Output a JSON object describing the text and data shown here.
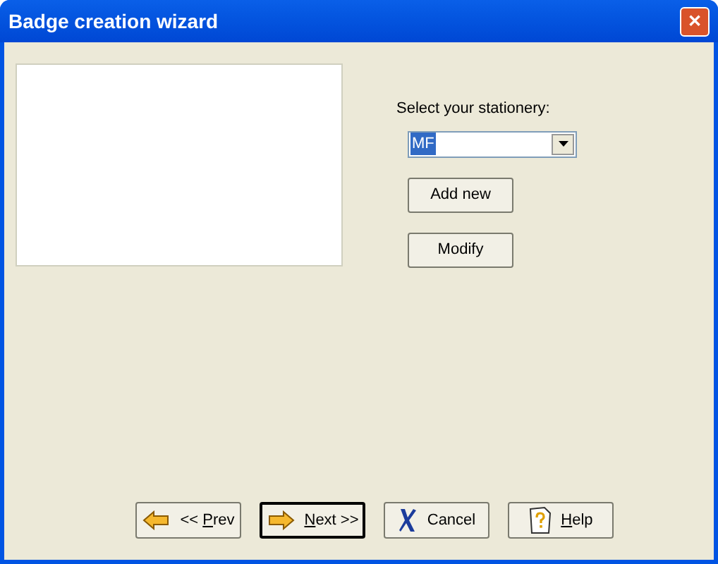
{
  "window": {
    "title": "Badge creation wizard",
    "close": "✕"
  },
  "preview": {
    "kind": "blank"
  },
  "stationery": {
    "label": "Select your stationery:",
    "value": "MF",
    "selected_text": true
  },
  "side_buttons": [
    {
      "label": "Add new"
    },
    {
      "label": "Modify"
    }
  ],
  "nav_buttons": [
    {
      "kind": "prev",
      "before": "<< ",
      "key": "P",
      "after": "rev",
      "default": false
    },
    {
      "kind": "next",
      "key": "N",
      "after": "ext >>",
      "default": true
    },
    {
      "kind": "cancel",
      "before": "Cancel",
      "default": false
    },
    {
      "kind": "help",
      "key": "H",
      "after": "elp",
      "default": false
    }
  ]
}
